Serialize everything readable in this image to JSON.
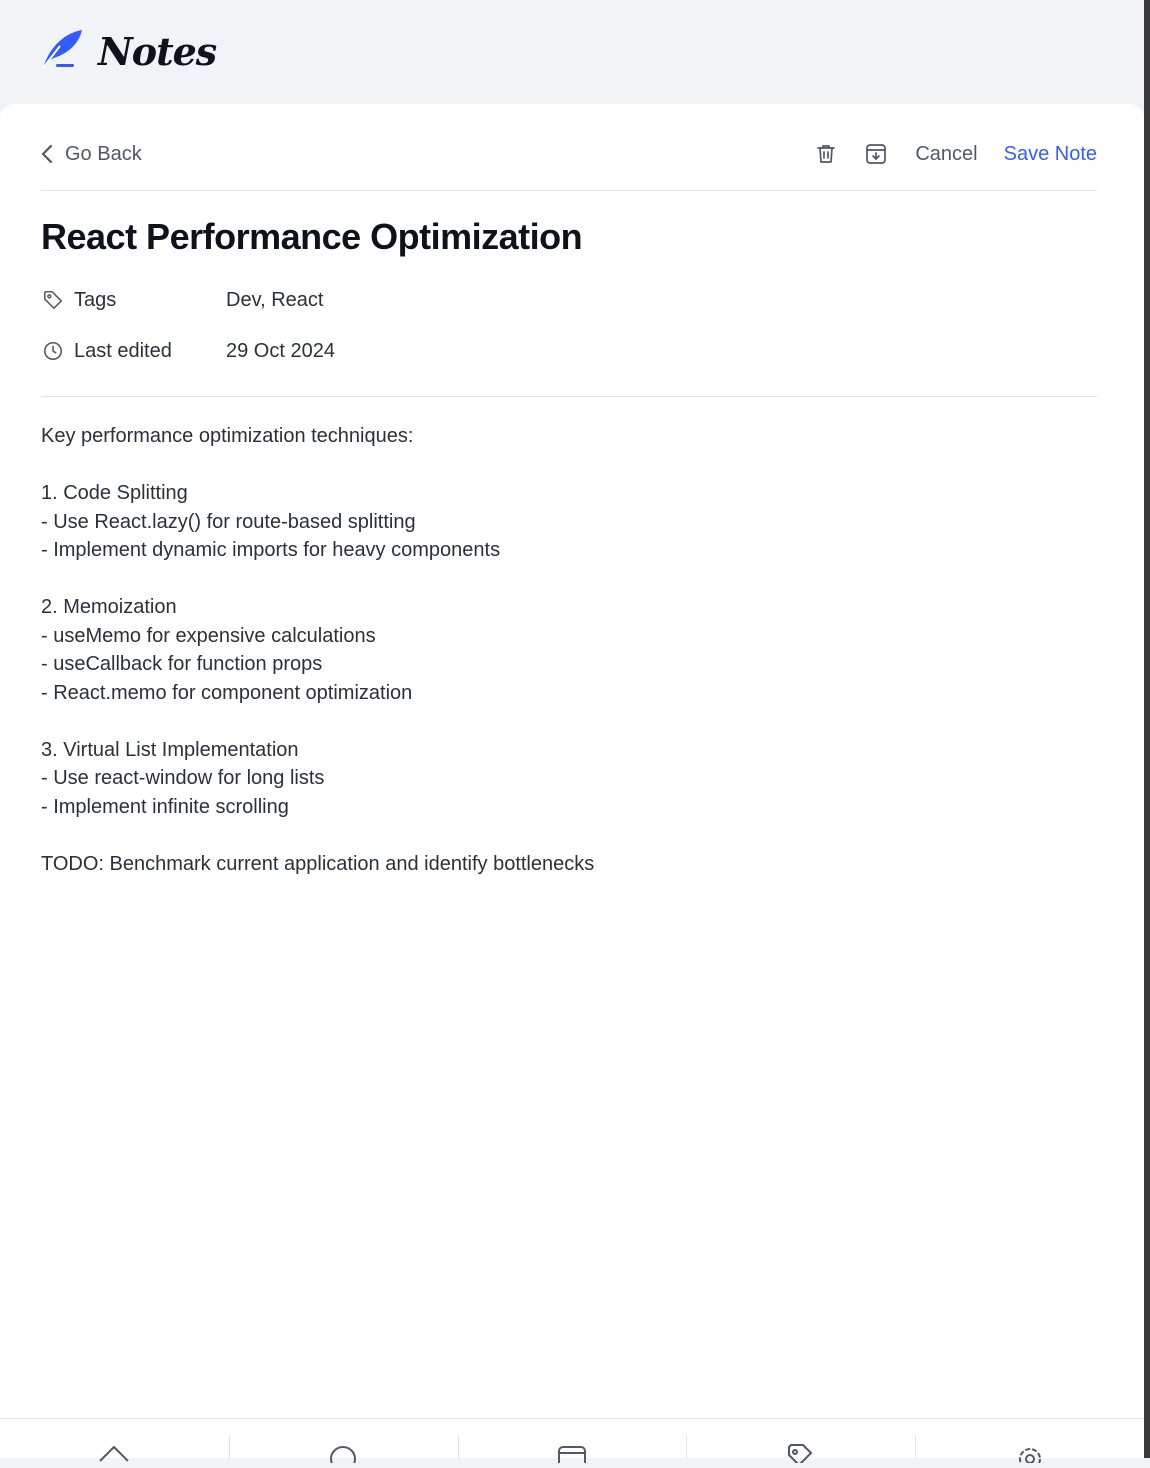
{
  "app": {
    "name": "Notes",
    "accent_color": "#335cff"
  },
  "header": {
    "back_label": "Go Back",
    "delete_icon": "trash-icon",
    "archive_icon": "archive-icon",
    "cancel_label": "Cancel",
    "save_label": "Save Note"
  },
  "note": {
    "title": "React Performance Optimization",
    "meta": {
      "tags_label": "Tags",
      "tags_value": "Dev, React",
      "edited_label": "Last edited",
      "edited_value": "29 Oct 2024"
    },
    "content": {
      "intro": "Key performance optimization techniques:",
      "s1_heading": "1. Code Splitting",
      "s1_l1": "- Use React.lazy() for route-based splitting",
      "s1_l2": "- Implement dynamic imports for heavy components",
      "s2_heading": "2. Memoization",
      "s2_l1": "- useMemo for expensive calculations",
      "s2_l2": "- useCallback for function props",
      "s2_l3": "- React.memo for component optimization",
      "s3_heading": "3. Virtual List Implementation",
      "s3_l1": "- Use react-window for long lists",
      "s3_l2": "- Implement infinite scrolling",
      "todo": "TODO: Benchmark current application and identify bottlenecks"
    }
  },
  "bottom_nav": {
    "items": [
      "home-icon",
      "search-icon",
      "archive-icon",
      "tag-icon",
      "settings-icon"
    ]
  }
}
